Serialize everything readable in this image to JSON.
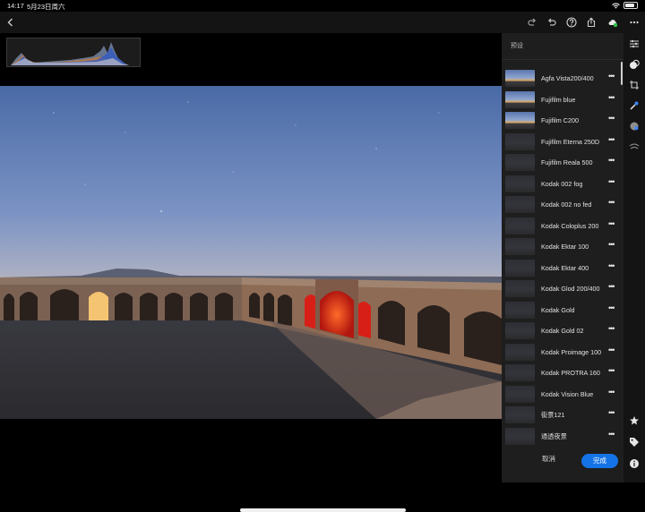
{
  "status_bar": {
    "time": "14:17",
    "date": "5月23日周六"
  },
  "toolbar": {
    "back_icon": "chevron-left-icon",
    "redo_icon": "redo-icon",
    "undo_icon": "undo-icon",
    "help_icon": "help-icon",
    "share_icon": "share-icon",
    "cloud_icon": "cloud-sync-icon",
    "more_icon": "more-icon"
  },
  "panel": {
    "title": "预设",
    "more_glyph": "•••",
    "presets": [
      {
        "label": "Agfa Vista200/400",
        "thumb": "sky"
      },
      {
        "label": "Fujifilm blue",
        "thumb": "sky"
      },
      {
        "label": "Fujifilm C200",
        "thumb": "sky"
      },
      {
        "label": "Fujifilm Eterna 250D",
        "thumb": "dark"
      },
      {
        "label": "Fujifilm Reala 500",
        "thumb": "dark"
      },
      {
        "label": "Kodak 002 fog",
        "thumb": "dark"
      },
      {
        "label": "Kodak 002 no fed",
        "thumb": "dark"
      },
      {
        "label": "Kodak Coloplus 200",
        "thumb": "dark"
      },
      {
        "label": "Kodak Ektar 100",
        "thumb": "dark"
      },
      {
        "label": "Kodak Ektar 400",
        "thumb": "dark"
      },
      {
        "label": "Kodak Glod 200/400",
        "thumb": "dark"
      },
      {
        "label": "Kodak Gold",
        "thumb": "dark"
      },
      {
        "label": "Kodak Gold 02",
        "thumb": "dark"
      },
      {
        "label": "Kodak Proimage 100",
        "thumb": "dark"
      },
      {
        "label": "Kodak PROTRA 160",
        "thumb": "dark"
      },
      {
        "label": "Kodak Vision Blue",
        "thumb": "dark"
      },
      {
        "label": "街景121",
        "thumb": "dark"
      },
      {
        "label": "通透夜景",
        "thumb": "dark"
      }
    ],
    "cancel_label": "取消",
    "done_label": "完成"
  },
  "rail": {
    "icons": [
      "sliders-icon",
      "presets-icon",
      "crop-icon",
      "healing-icon",
      "selective-icon",
      "optics-icon",
      "star-icon",
      "tag-icon",
      "info-icon"
    ]
  },
  "colors": {
    "accent": "#1473e6",
    "panel_bg": "#1e1e1e",
    "toolbar_bg": "#141414"
  }
}
